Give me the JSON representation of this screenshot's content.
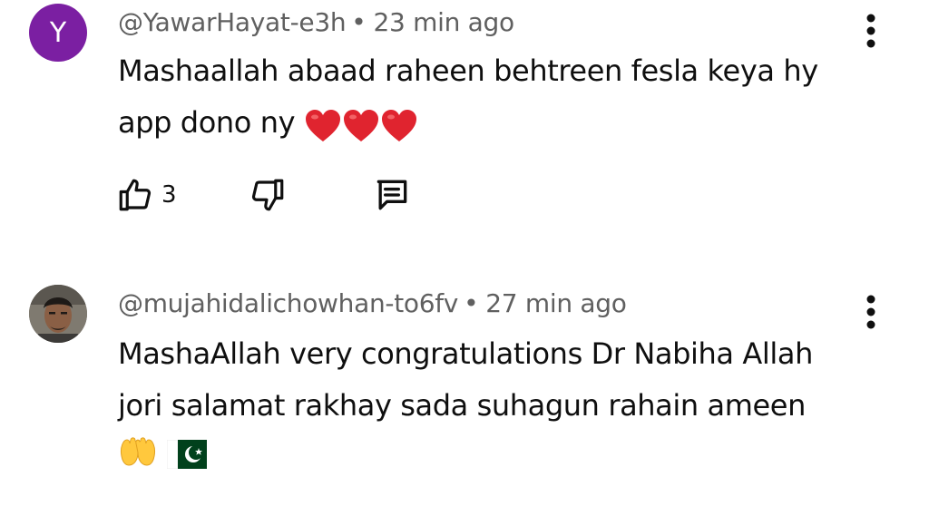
{
  "comments": [
    {
      "avatar_letter": "Y",
      "avatar_color": "#7b1fa2",
      "author": "@YawarHayat-e3h",
      "separator": "•",
      "time": "23 min ago",
      "text_line1": "Mashaallah abaad raheen behtreen fesla keya hy",
      "text_line2": "app dono  ny",
      "emojis": [
        "red-heart",
        "red-heart",
        "red-heart"
      ],
      "like_count": "3",
      "icons": [
        "thumbs-up-icon",
        "thumbs-down-icon",
        "reply-icon",
        "more-vert-icon"
      ]
    },
    {
      "author": "@mujahidalichowhan-to6fv",
      "separator": "•",
      "time": "27 min ago",
      "text_line1": "MashaAllah very congratulations Dr Nabiha Allah",
      "text_line2": "jori salamat rakhay sada suhagun rahain ameen",
      "emojis": [
        "palms-up-together",
        "pakistan-flag"
      ],
      "icons": [
        "more-vert-icon"
      ]
    }
  ],
  "colors": {
    "text": "#0f0f0f",
    "meta": "#606060",
    "heart": "#e0242f",
    "flag_green": "#01411c"
  }
}
